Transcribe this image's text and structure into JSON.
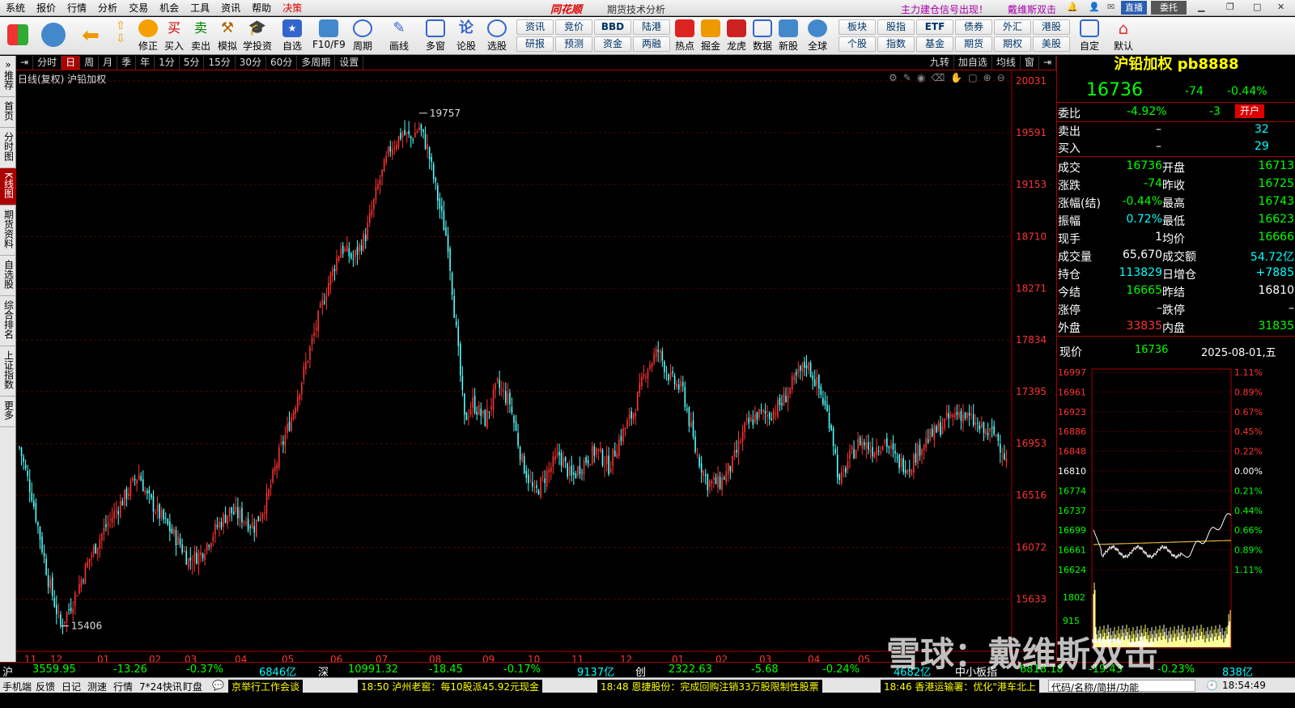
{
  "menu": [
    "系统",
    "报价",
    "行情",
    "分析",
    "交易",
    "机会",
    "工具",
    "资讯",
    "帮助"
  ],
  "menu_hot": "决策",
  "app_brand": "同花顺",
  "app_title": "期货技术分析",
  "promo1": "主力建仓信号出现！",
  "promo2": "戴维斯双击",
  "btn_live": "直播",
  "btn_entrust": "委托",
  "toolbar": [
    "修正",
    "买入",
    "卖出",
    "模拟",
    "学投资",
    "自选",
    "F10/F9",
    "周期",
    "画线",
    "多窗",
    "论股",
    "选股",
    "",
    "",
    "",
    "",
    "热点",
    "掘金",
    "龙虎",
    "数据",
    "新股",
    "全球",
    "",
    "",
    "",
    "",
    "自定",
    "默认"
  ],
  "pills_top": [
    "资讯",
    "竞价",
    "BBD",
    "陆港",
    "板块",
    "股指",
    "ETF",
    "债券",
    "外汇",
    "港股"
  ],
  "pills_bottom": [
    "研报",
    "预测",
    "资金",
    "两融",
    "个股",
    "指数",
    "基金",
    "期货",
    "期权",
    "美股"
  ],
  "left_tabs": [
    "推荐",
    "首页",
    "分时图",
    "K线图",
    "期货资料",
    "自选股",
    "综合排名",
    "上证指数",
    "更多"
  ],
  "periods": [
    "分时",
    "日",
    "周",
    "月",
    "季",
    "年",
    "1分",
    "5分",
    "15分",
    "30分",
    "60分",
    "多周期",
    "设置"
  ],
  "period_right": [
    "九转",
    "加自选",
    "均线",
    "窗"
  ],
  "chart_title": "日线(复权) 沪铅加权",
  "instrument": {
    "name": "沪铅加权",
    "code": "pb8888",
    "price": "16736",
    "change": "-74",
    "change_pct": "-0.44%",
    "open_account": "开户"
  },
  "quote": {
    "weibi_label": "委比",
    "weibi": "-4.92%",
    "weicha": "-3",
    "sell_label": "卖出",
    "sell": "–",
    "sell_vol": "32",
    "buy_label": "买入",
    "buy": "–",
    "buy_vol": "29",
    "rows": [
      {
        "l1": "成交",
        "v1": "16736",
        "l2": "开盘",
        "v2": "16713"
      },
      {
        "l1": "涨跌",
        "v1": "-74",
        "l2": "昨收",
        "v2": "16725"
      },
      {
        "l1": "涨幅(结)",
        "v1": "-0.44%",
        "l2": "最高",
        "v2": "16743"
      },
      {
        "l1": "振幅",
        "v1": "0.72%",
        "l2": "最低",
        "v2": "16623"
      },
      {
        "l1": "现手",
        "v1": "1",
        "l2": "均价",
        "v2": "16666"
      },
      {
        "l1": "成交量",
        "v1": "65,670",
        "l2": "成交额",
        "v2": "54.72亿"
      },
      {
        "l1": "持仓",
        "v1": "113829",
        "l2": "日增仓",
        "v2": "+7885"
      },
      {
        "l1": "今结",
        "v1": "16665",
        "l2": "昨结",
        "v2": "16810"
      },
      {
        "l1": "涨停",
        "v1": "–",
        "l2": "跌停",
        "v2": "–"
      },
      {
        "l1": "外盘",
        "v1": "33835",
        "l2": "内盘",
        "v2": "31835"
      }
    ],
    "now_label": "现价",
    "now_price": "16736",
    "date": "2025-08-01,五"
  },
  "mini_left_ticks": [
    "16997",
    "16961",
    "16923",
    "16886",
    "16848",
    "16810",
    "16774",
    "16737",
    "16699",
    "16661",
    "16624"
  ],
  "mini_right_ticks": [
    "1.11%",
    "0.89%",
    "0.67%",
    "0.45%",
    "0.22%",
    "0.00%",
    "0.21%",
    "0.44%",
    "0.66%",
    "0.89%",
    "1.11%"
  ],
  "mini_vol_ticks": [
    "1802",
    "915"
  ],
  "chart_data": {
    "type": "candlestick",
    "title": "日线(复权) 沪铅加权",
    "y_ticks": [
      20031,
      19591,
      19153,
      18710,
      18271,
      17834,
      17395,
      16953,
      16516,
      16072,
      15633
    ],
    "ylim": [
      15190,
      20120
    ],
    "x_month_labels": [
      "11",
      "12",
      "01",
      "02",
      "03",
      "04",
      "05",
      "06",
      "07",
      "08",
      "09",
      "10",
      "11",
      "12",
      "01",
      "02",
      "03",
      "04",
      "05"
    ],
    "annotations": [
      {
        "label": "19757",
        "value": 19757
      },
      {
        "label": "15406",
        "value": 15406
      }
    ],
    "close_path_keypoints": [
      [
        0,
        16920
      ],
      [
        6,
        16520
      ],
      [
        14,
        15800
      ],
      [
        20,
        15406
      ],
      [
        26,
        15620
      ],
      [
        34,
        15980
      ],
      [
        42,
        16250
      ],
      [
        50,
        16470
      ],
      [
        58,
        16700
      ],
      [
        62,
        16500
      ],
      [
        70,
        16300
      ],
      [
        78,
        16100
      ],
      [
        82,
        15960
      ],
      [
        88,
        16020
      ],
      [
        96,
        16250
      ],
      [
        102,
        16380
      ],
      [
        108,
        16330
      ],
      [
        114,
        16250
      ],
      [
        120,
        16470
      ],
      [
        126,
        16860
      ],
      [
        132,
        17180
      ],
      [
        138,
        17560
      ],
      [
        144,
        17950
      ],
      [
        150,
        18320
      ],
      [
        156,
        18620
      ],
      [
        162,
        18520
      ],
      [
        168,
        18720
      ],
      [
        174,
        19140
      ],
      [
        180,
        19460
      ],
      [
        186,
        19590
      ],
      [
        190,
        19540
      ],
      [
        194,
        19640
      ],
      [
        198,
        19460
      ],
      [
        204,
        18950
      ],
      [
        208,
        18650
      ],
      [
        212,
        17900
      ],
      [
        216,
        17150
      ],
      [
        220,
        17300
      ],
      [
        226,
        17150
      ],
      [
        232,
        17450
      ],
      [
        238,
        17300
      ],
      [
        244,
        16800
      ],
      [
        250,
        16520
      ],
      [
        256,
        16700
      ],
      [
        262,
        16860
      ],
      [
        268,
        16660
      ],
      [
        274,
        16800
      ],
      [
        280,
        16900
      ],
      [
        286,
        16760
      ],
      [
        292,
        17020
      ],
      [
        298,
        17220
      ],
      [
        304,
        17580
      ],
      [
        310,
        17740
      ],
      [
        316,
        17500
      ],
      [
        322,
        17400
      ],
      [
        328,
        16900
      ],
      [
        334,
        16620
      ],
      [
        340,
        16620
      ],
      [
        346,
        16780
      ],
      [
        352,
        17080
      ],
      [
        358,
        17200
      ],
      [
        364,
        17200
      ],
      [
        370,
        17300
      ],
      [
        376,
        17480
      ],
      [
        382,
        17640
      ],
      [
        388,
        17420
      ],
      [
        394,
        17100
      ],
      [
        398,
        16600
      ],
      [
        402,
        16800
      ],
      [
        408,
        16980
      ],
      [
        414,
        16900
      ],
      [
        420,
        16980
      ],
      [
        426,
        16800
      ],
      [
        432,
        16760
      ],
      [
        438,
        16950
      ],
      [
        444,
        17040
      ],
      [
        450,
        17150
      ],
      [
        456,
        17220
      ],
      [
        462,
        17150
      ],
      [
        468,
        17050
      ],
      [
        474,
        17030
      ],
      [
        480,
        16760
      ]
    ],
    "candle_count": 480,
    "volume_scale_note": ""
  },
  "status": {
    "sh_label": "沪",
    "sh": "3559.95",
    "sh_chg": "-13.26",
    "sh_pct": "-0.37%",
    "sh_amt": "6846亿",
    "sz_label": "深",
    "sz": "10991.32",
    "sz_chg": "-18.45",
    "sz_pct": "-0.17%",
    "sz_amt": "9137亿",
    "cy_label": "创",
    "cy": "2322.63",
    "cy_chg": "-5.68",
    "cy_pct": "-0.24%",
    "cy_amt": "4682亿",
    "zx_label": "中小板指",
    "zx": "6818.18",
    "zx_chg": "-19.43",
    "zx_pct": "-0.23%",
    "zx_amt": "838亿"
  },
  "news": {
    "left": [
      "手机端",
      "反馈",
      "日记",
      "测速",
      "行情",
      "7*24快讯",
      "盯盘"
    ],
    "items": [
      "京举行工作会谈",
      "18:50 泸州老窖：每10股派45.92元现金",
      "18:48 恩捷股份：完成回购注销33万股限制性股票",
      "18:46 香港运输署：优化\"港车北上"
    ],
    "search": "代码/名称/简拼/功能",
    "time": "18:54:49"
  },
  "watermark": "雪球：戴维斯双击",
  "colors": {
    "up": "#ff3333",
    "down": "#54ffff",
    "axis_red": "#aa0000",
    "grid": "#550000"
  }
}
